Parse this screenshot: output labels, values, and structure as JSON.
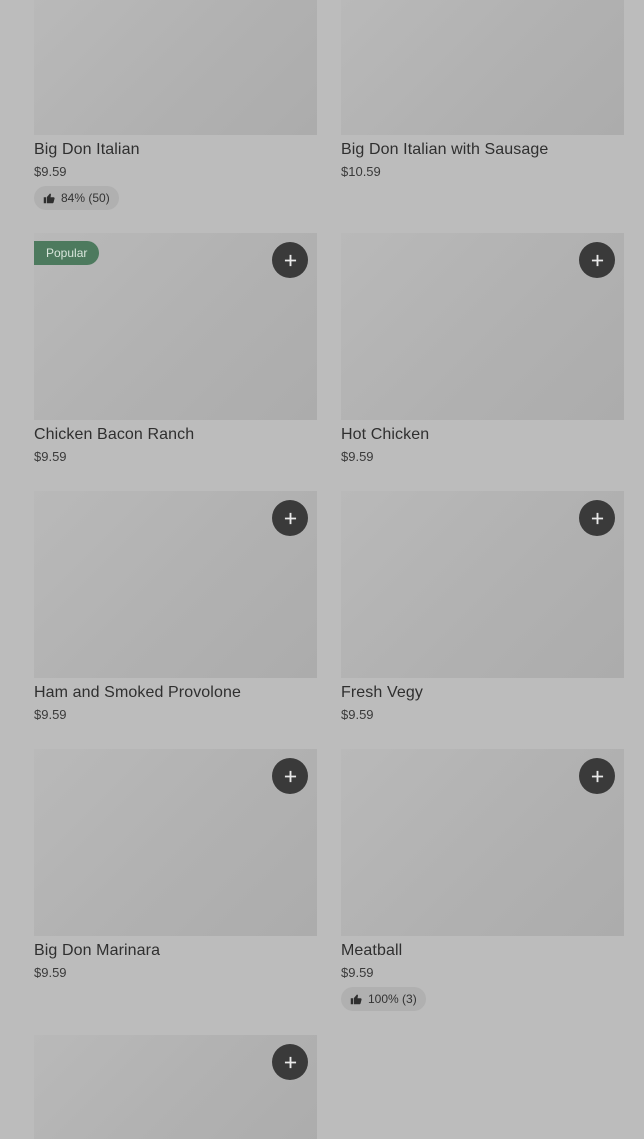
{
  "items": [
    {
      "name": "Big Don Italian",
      "price": "$9.59",
      "rating": "84% (50)"
    },
    {
      "name": "Big Don Italian with Sausage",
      "price": "$10.59"
    },
    {
      "name": "Chicken Bacon Ranch",
      "price": "$9.59",
      "badge": "Popular"
    },
    {
      "name": "Hot Chicken",
      "price": "$9.59"
    },
    {
      "name": "Ham and Smoked Provolone",
      "price": "$9.59"
    },
    {
      "name": "Fresh Vegy",
      "price": "$9.59"
    },
    {
      "name": "Big Don Marinara",
      "price": "$9.59"
    },
    {
      "name": "Meatball",
      "price": "$9.59",
      "rating": "100% (3)"
    }
  ],
  "icons": {
    "add": "plus-icon",
    "rating": "thumbs-up-icon"
  },
  "colors": {
    "badge_bg": "#4d7a5e",
    "add_button_bg": "#3a3a3a",
    "overlay_bg": "#bcbcbc"
  }
}
